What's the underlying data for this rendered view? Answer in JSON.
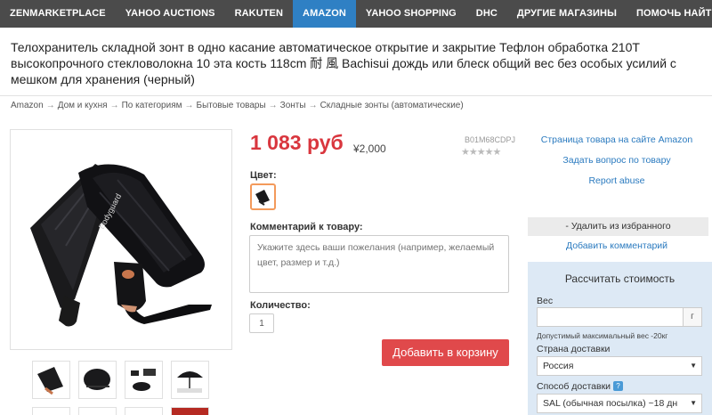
{
  "nav": {
    "items": [
      "ZENMARKETPLACE",
      "YAHOO AUCTIONS",
      "RAKUTEN",
      "AMAZON",
      "YAHOO SHOPPING",
      "DHC",
      "ДРУГИЕ МАГАЗИНЫ",
      "ПОМОЧЬ НАЙТИ"
    ],
    "active": "AMAZON"
  },
  "product": {
    "title": "Телохранитель складной зонт в одно касание автоматическое открытие и закрытие Тефлон обработка 210T высокопрочного стекловолокна 10 эта кость 118cm 耐 風 Bachisui дождь или блеск общий вес без особых усилий с мешком для хранения (черный)",
    "price": "1 083 руб",
    "price_yen": "¥2,000",
    "sku": "B01M68CDPJ",
    "rating_stars": "★★★★★",
    "rating": 0,
    "color_label": "Цвет:",
    "comment_label": "Комментарий к товару:",
    "comment_placeholder": "Укажите здесь ваши пожелания (например, желаемый цвет, размер и т.д.)",
    "quantity_label": "Количество:",
    "quantity": "1",
    "add_to_cart": "Добавить в корзину",
    "brand_on_image": "Bodyguard"
  },
  "breadcrumb": [
    "Amazon",
    "Дом и кухня",
    "По категориям",
    "Бытовые товары",
    "Зонты",
    "Складные зонты (автоматические)"
  ],
  "breadcrumb_sep": "→",
  "sidebar": {
    "link_amazon": "Страница товара на сайте Amazon",
    "link_ask": "Задать вопрос по товару",
    "link_report": "Report abuse",
    "remove_fav": "- Удалить из избранного",
    "add_comment": "Добавить комментарий"
  },
  "calc": {
    "title": "Рассчитать стоимость",
    "weight_label": "Вес",
    "weight_unit": "г",
    "weight_hint": "Допустимый максимальный вес -20кг",
    "country_label": "Страна доставки",
    "country_value": "Россия",
    "shipping_label": "Способ доставки",
    "help_icon": "?",
    "shipping_value": "SAL (обычная посылка) ~18 дн"
  },
  "colors": {
    "nav_bg": "#4b4b4b",
    "nav_active": "#2f80c4",
    "price": "#d9363e",
    "cart_button": "#e0494b",
    "link": "#2a7abf",
    "calc_bg": "#dde9f5",
    "swatch_border": "#f39a5b"
  }
}
